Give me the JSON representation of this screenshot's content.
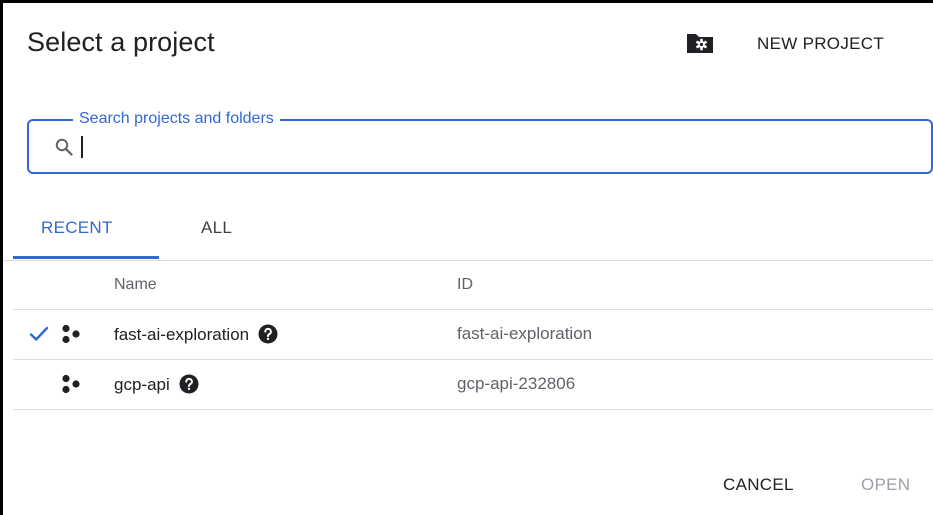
{
  "dialog": {
    "title": "Select a project",
    "new_project_label": "NEW PROJECT"
  },
  "search": {
    "label": "Search projects and folders",
    "value": "",
    "placeholder": ""
  },
  "tabs": [
    {
      "label": "RECENT",
      "active": true
    },
    {
      "label": "ALL",
      "active": false
    }
  ],
  "table": {
    "headers": {
      "name": "Name",
      "id": "ID"
    },
    "rows": [
      {
        "name": "fast-ai-exploration",
        "id": "fast-ai-exploration",
        "selected": true,
        "icon": "project-icon",
        "help_icon": "help-icon"
      },
      {
        "name": "gcp-api",
        "id": "gcp-api-232806",
        "selected": false,
        "icon": "project-icon",
        "help_icon": "help-icon"
      }
    ]
  },
  "footer": {
    "cancel_label": "CANCEL",
    "open_label": "OPEN"
  },
  "colors": {
    "accent": "#3367d6",
    "text": "#202124",
    "muted": "#5f6368",
    "disabled": "#9aa0a6",
    "divider": "#dadce0"
  }
}
